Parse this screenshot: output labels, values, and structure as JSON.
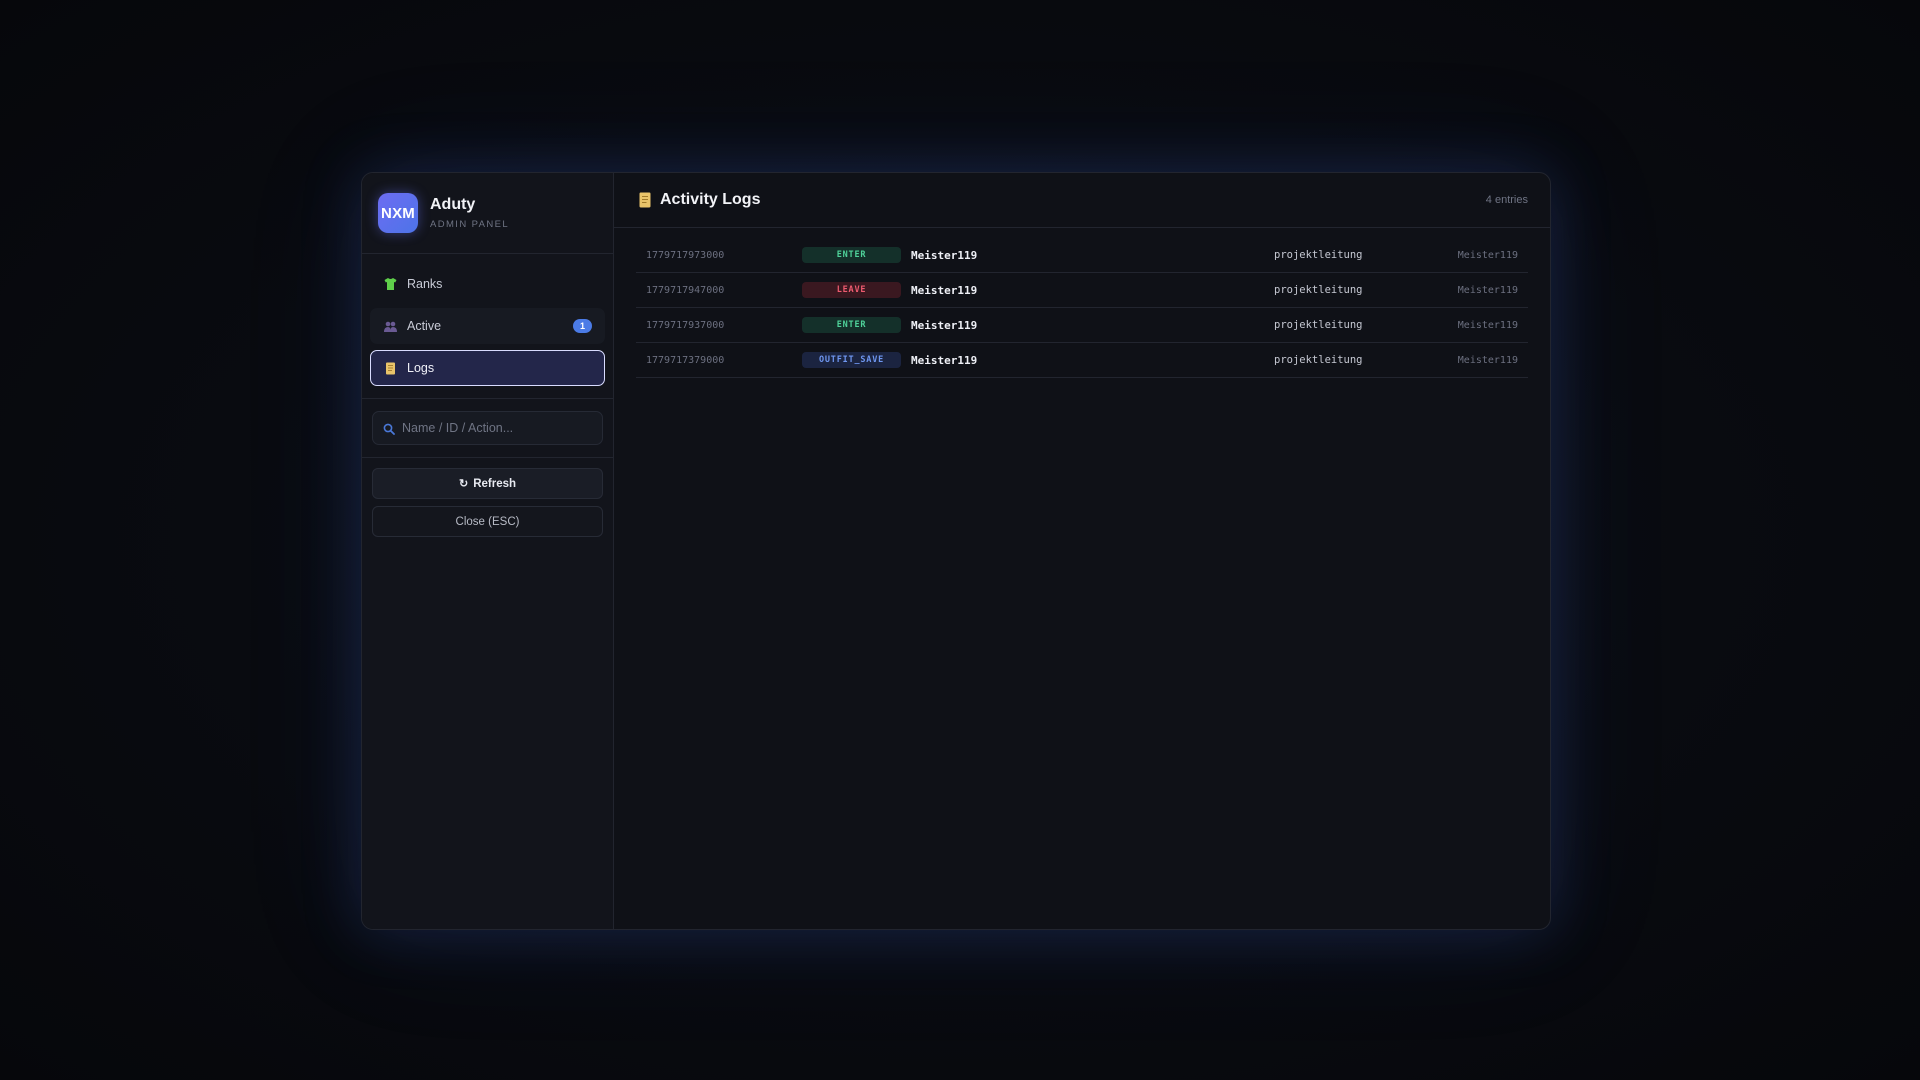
{
  "brand": {
    "logo_text": "NXM",
    "title": "Aduty",
    "subtitle": "ADMIN PANEL"
  },
  "nav": {
    "items": [
      {
        "label": "Ranks",
        "icon": "shirt-icon",
        "active": false
      },
      {
        "label": "Active",
        "icon": "users-icon",
        "badge": "1",
        "active": false
      },
      {
        "label": "Logs",
        "icon": "scroll-icon",
        "active": true
      }
    ]
  },
  "search": {
    "placeholder": "Name / ID / Action..."
  },
  "actions": {
    "refresh_label": "Refresh",
    "close_label": "Close (ESC)"
  },
  "main": {
    "title": "Activity Logs",
    "entries": "4 entries",
    "logs": [
      {
        "timestamp": "1779717973000",
        "action": "ENTER",
        "name": "Meister119",
        "group": "projektleitung",
        "by": "Meister119"
      },
      {
        "timestamp": "1779717947000",
        "action": "LEAVE",
        "name": "Meister119",
        "group": "projektleitung",
        "by": "Meister119"
      },
      {
        "timestamp": "1779717937000",
        "action": "ENTER",
        "name": "Meister119",
        "group": "projektleitung",
        "by": "Meister119"
      },
      {
        "timestamp": "1779717379000",
        "action": "OUTFIT_SAVE",
        "name": "Meister119",
        "group": "projektleitung",
        "by": "Meister119"
      }
    ]
  },
  "colors": {
    "accent": "#4b7be6",
    "enter": "#4fd29a",
    "leave": "#ee5b6f",
    "outfit_save": "#6f97f0"
  }
}
